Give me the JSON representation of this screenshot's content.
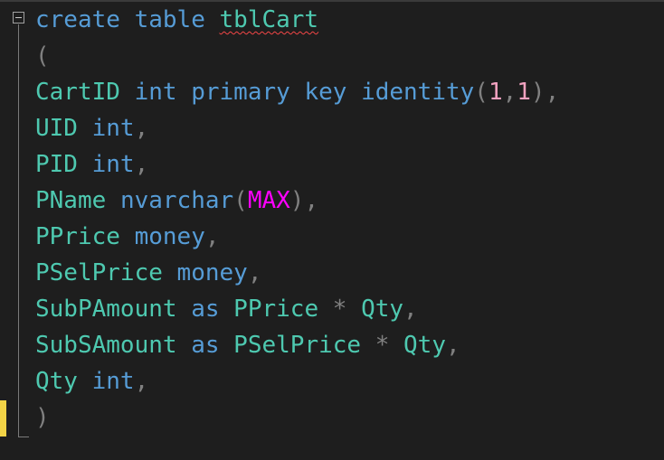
{
  "editor": {
    "language": "sql",
    "lines": [
      {
        "tokens": [
          {
            "t": "create",
            "c": "kw"
          },
          {
            "t": " ",
            "c": "punc"
          },
          {
            "t": "table",
            "c": "kw"
          },
          {
            "t": " ",
            "c": "punc"
          },
          {
            "t": "tblCart",
            "c": "ident squiggle"
          }
        ]
      },
      {
        "tokens": [
          {
            "t": "(",
            "c": "punc"
          }
        ]
      },
      {
        "tokens": [
          {
            "t": "CartID",
            "c": "ident"
          },
          {
            "t": " ",
            "c": "punc"
          },
          {
            "t": "int",
            "c": "kw"
          },
          {
            "t": " ",
            "c": "punc"
          },
          {
            "t": "primary",
            "c": "kw"
          },
          {
            "t": " ",
            "c": "punc"
          },
          {
            "t": "key",
            "c": "kw"
          },
          {
            "t": " ",
            "c": "punc"
          },
          {
            "t": "identity",
            "c": "kw"
          },
          {
            "t": "(",
            "c": "punc"
          },
          {
            "t": "1",
            "c": "num"
          },
          {
            "t": ",",
            "c": "punc"
          },
          {
            "t": "1",
            "c": "num"
          },
          {
            "t": "),",
            "c": "punc"
          }
        ]
      },
      {
        "tokens": [
          {
            "t": "UID",
            "c": "ident"
          },
          {
            "t": " ",
            "c": "punc"
          },
          {
            "t": "int",
            "c": "kw"
          },
          {
            "t": ",",
            "c": "punc"
          }
        ]
      },
      {
        "tokens": [
          {
            "t": "PID",
            "c": "ident"
          },
          {
            "t": " ",
            "c": "punc"
          },
          {
            "t": "int",
            "c": "kw"
          },
          {
            "t": ",",
            "c": "punc"
          }
        ]
      },
      {
        "tokens": [
          {
            "t": "PName",
            "c": "ident"
          },
          {
            "t": " ",
            "c": "punc"
          },
          {
            "t": "nvarchar",
            "c": "kw"
          },
          {
            "t": "(",
            "c": "punc"
          },
          {
            "t": "MAX",
            "c": "magenta"
          },
          {
            "t": "),",
            "c": "punc"
          }
        ]
      },
      {
        "tokens": [
          {
            "t": "PPrice",
            "c": "ident"
          },
          {
            "t": " ",
            "c": "punc"
          },
          {
            "t": "money",
            "c": "kw"
          },
          {
            "t": ",",
            "c": "punc"
          }
        ]
      },
      {
        "tokens": [
          {
            "t": "PSelPrice",
            "c": "ident"
          },
          {
            "t": " ",
            "c": "punc"
          },
          {
            "t": "money",
            "c": "kw"
          },
          {
            "t": ",",
            "c": "punc"
          }
        ]
      },
      {
        "tokens": [
          {
            "t": "SubPAmount",
            "c": "ident"
          },
          {
            "t": " ",
            "c": "punc"
          },
          {
            "t": "as",
            "c": "kw"
          },
          {
            "t": " ",
            "c": "punc"
          },
          {
            "t": "PPrice",
            "c": "ident"
          },
          {
            "t": " * ",
            "c": "punc"
          },
          {
            "t": "Qty",
            "c": "ident"
          },
          {
            "t": ",",
            "c": "punc"
          }
        ]
      },
      {
        "tokens": [
          {
            "t": "SubSAmount",
            "c": "ident"
          },
          {
            "t": " ",
            "c": "punc"
          },
          {
            "t": "as",
            "c": "kw"
          },
          {
            "t": " ",
            "c": "punc"
          },
          {
            "t": "PSelPrice",
            "c": "ident"
          },
          {
            "t": " * ",
            "c": "punc"
          },
          {
            "t": "Qty",
            "c": "ident"
          },
          {
            "t": ",",
            "c": "punc"
          }
        ]
      },
      {
        "tokens": [
          {
            "t": "Qty",
            "c": "ident"
          },
          {
            "t": " ",
            "c": "punc"
          },
          {
            "t": "int",
            "c": "kw"
          },
          {
            "t": ",",
            "c": "punc"
          }
        ]
      },
      {
        "tokens": [
          {
            "t": ")",
            "c": "punc"
          }
        ]
      }
    ]
  },
  "colors": {
    "background": "#1e1e1e",
    "keyword": "#569cd6",
    "identifier": "#4ec9b0",
    "punctuation": "#808080",
    "number": "#f2a2c0",
    "max_keyword": "#ff00ff",
    "squiggle": "#f44747",
    "change_bar": "#f2d346"
  },
  "icons": {
    "fold": "collapse-minus-icon"
  }
}
